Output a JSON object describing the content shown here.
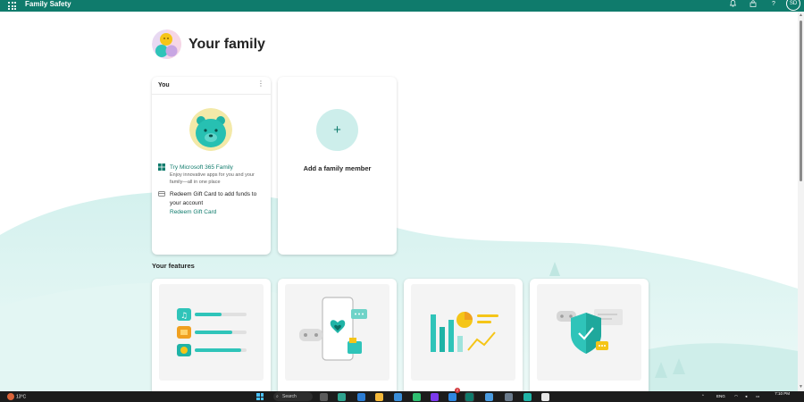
{
  "header": {
    "app_title": "Family Safety",
    "avatar_initials": "SD",
    "help_glyph": "?",
    "icons": [
      "waffle-icon",
      "bell-icon",
      "rewards-icon",
      "help-icon"
    ],
    "color": "#0f7b6c"
  },
  "page": {
    "title": "Your family"
  },
  "you_card": {
    "label": "You",
    "more_glyph": "⋮",
    "promo_m365": {
      "link": "Try Microsoft 365 Family",
      "description": "Enjoy innovative apps for you and your family—all in one place"
    },
    "promo_gift": {
      "text": "Redeem Gift Card to add funds to your account",
      "link": "Redeem Gift Card"
    }
  },
  "add_card": {
    "plus": "+",
    "label": "Add a family member"
  },
  "features": {
    "title": "Your features",
    "cards": [
      "screen-time",
      "content-filters",
      "activity",
      "safety"
    ]
  },
  "taskbar": {
    "weather_temp": "13°C",
    "search_label": "Search",
    "language": "ENG",
    "time": "7:10 PM",
    "notification_badge": "2"
  },
  "colors": {
    "accent": "#0f7b6c",
    "teal_light": "#cdeeeb",
    "teal_mid": "#2fc4b9",
    "yellow": "#f5c518"
  }
}
